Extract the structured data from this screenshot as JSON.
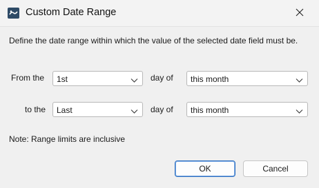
{
  "window": {
    "title": "Custom Date Range",
    "icon": "app-icon",
    "close_icon": "close-icon"
  },
  "dialog": {
    "description": "Define the date range within which the value of the selected date field must be.",
    "from_row": {
      "label": "From the",
      "day_value": "1st",
      "day_of_label": "day of",
      "period_value": "this month"
    },
    "to_row": {
      "label": "to the",
      "day_value": "Last",
      "day_of_label": "day of",
      "period_value": "this month"
    },
    "note": "Note: Range limits are inclusive"
  },
  "buttons": {
    "ok": "OK",
    "cancel": "Cancel"
  },
  "colors": {
    "accent": "#2f70c0",
    "window_bg": "#f0f0f0"
  }
}
